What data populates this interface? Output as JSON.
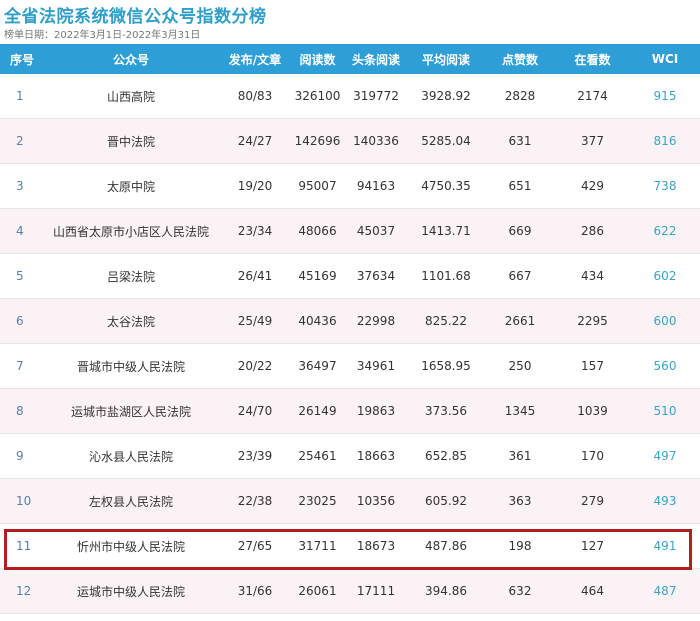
{
  "title": "全省法院系统微信公众号指数分榜",
  "subtitle": "榜单日期：2022年3月1日-2022年3月31日",
  "headers": [
    "序号",
    "公众号",
    "发布/文章",
    "阅读数",
    "头条阅读",
    "平均阅读",
    "点赞数",
    "在看数",
    "WCI"
  ],
  "rows": [
    [
      "1",
      "山西高院",
      "80/83",
      "326100",
      "319772",
      "3928.92",
      "2828",
      "2174",
      "915"
    ],
    [
      "2",
      "晋中法院",
      "24/27",
      "142696",
      "140336",
      "5285.04",
      "631",
      "377",
      "816"
    ],
    [
      "3",
      "太原中院",
      "19/20",
      "95007",
      "94163",
      "4750.35",
      "651",
      "429",
      "738"
    ],
    [
      "4",
      "山西省太原市小店区人民法院",
      "23/34",
      "48066",
      "45037",
      "1413.71",
      "669",
      "286",
      "622"
    ],
    [
      "5",
      "吕梁法院",
      "26/41",
      "45169",
      "37634",
      "1101.68",
      "667",
      "434",
      "602"
    ],
    [
      "6",
      "太谷法院",
      "25/49",
      "40436",
      "22998",
      "825.22",
      "2661",
      "2295",
      "600"
    ],
    [
      "7",
      "晋城市中级人民法院",
      "20/22",
      "36497",
      "34961",
      "1658.95",
      "250",
      "157",
      "560"
    ],
    [
      "8",
      "运城市盐湖区人民法院",
      "24/70",
      "26149",
      "19863",
      "373.56",
      "1345",
      "1039",
      "510"
    ],
    [
      "9",
      "沁水县人民法院",
      "23/39",
      "25461",
      "18663",
      "652.85",
      "361",
      "170",
      "497"
    ],
    [
      "10",
      "左权县人民法院",
      "22/38",
      "23025",
      "10356",
      "605.92",
      "363",
      "279",
      "493"
    ],
    [
      "11",
      "忻州市中级人民法院",
      "27/65",
      "31711",
      "18673",
      "487.86",
      "198",
      "127",
      "491"
    ],
    [
      "12",
      "运城市中级人民法院",
      "31/66",
      "26061",
      "17111",
      "394.86",
      "632",
      "464",
      "487"
    ]
  ],
  "highlight_row": 11,
  "colors": {
    "header_bg": "#2e9ed6",
    "title": "#2f9fc8",
    "highlight_border": "#b21d1d",
    "alt_row": "#fbf2f5"
  }
}
